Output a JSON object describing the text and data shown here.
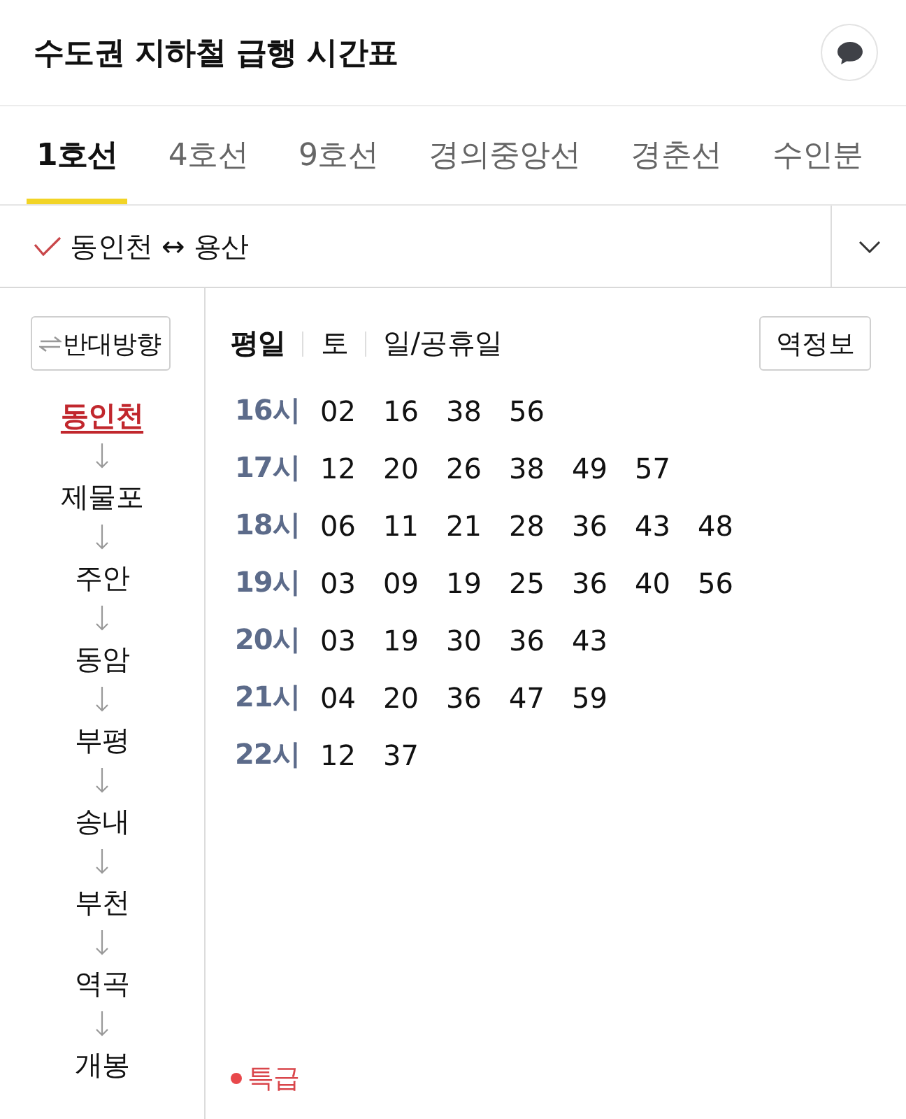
{
  "header": {
    "title": "수도권 지하철 급행 시간표"
  },
  "line_tabs": [
    {
      "label": "1호선",
      "selected": true
    },
    {
      "label": "4호선",
      "selected": false
    },
    {
      "label": "9호선",
      "selected": false
    },
    {
      "label": "경의중앙선",
      "selected": false
    },
    {
      "label": "경춘선",
      "selected": false
    },
    {
      "label": "수인분",
      "selected": false
    }
  ],
  "route": {
    "label": "동인천 ↔ 용산"
  },
  "reverse_button": {
    "label": "반대방향"
  },
  "stations": [
    {
      "name": "동인천",
      "selected": true
    },
    {
      "name": "제물포",
      "selected": false
    },
    {
      "name": "주안",
      "selected": false
    },
    {
      "name": "동암",
      "selected": false
    },
    {
      "name": "부평",
      "selected": false
    },
    {
      "name": "송내",
      "selected": false
    },
    {
      "name": "부천",
      "selected": false
    },
    {
      "name": "역곡",
      "selected": false
    },
    {
      "name": "개봉",
      "selected": false
    }
  ],
  "day_tabs": [
    {
      "label": "평일",
      "selected": true
    },
    {
      "label": "토",
      "selected": false
    },
    {
      "label": "일/공휴일",
      "selected": false
    }
  ],
  "station_info_button": {
    "label": "역정보"
  },
  "timetable": [
    {
      "hour": "16시",
      "minutes": [
        "02",
        "16",
        "38",
        "56"
      ]
    },
    {
      "hour": "17시",
      "minutes": [
        "12",
        "20",
        "26",
        "38",
        "49",
        "57"
      ]
    },
    {
      "hour": "18시",
      "minutes": [
        "06",
        "11",
        "21",
        "28",
        "36",
        "43",
        "48"
      ]
    },
    {
      "hour": "19시",
      "minutes": [
        "03",
        "09",
        "19",
        "25",
        "36",
        "40",
        "56"
      ]
    },
    {
      "hour": "20시",
      "minutes": [
        "03",
        "19",
        "30",
        "36",
        "43"
      ]
    },
    {
      "hour": "21시",
      "minutes": [
        "04",
        "20",
        "36",
        "47",
        "59"
      ]
    },
    {
      "hour": "22시",
      "minutes": [
        "12",
        "37"
      ]
    }
  ],
  "legend": {
    "label": "특급"
  }
}
